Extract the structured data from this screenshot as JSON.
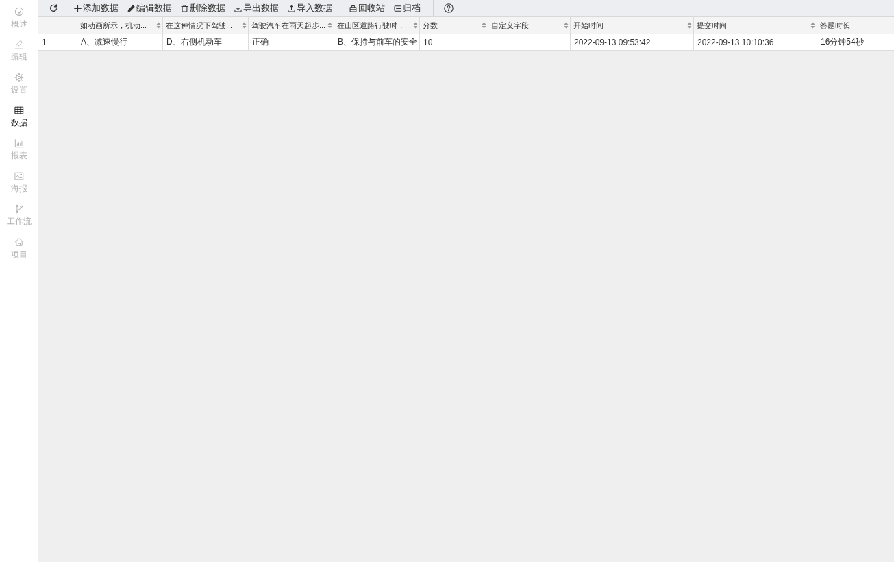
{
  "sidebar": {
    "items": [
      {
        "label": "概述",
        "selected": false
      },
      {
        "label": "编辑",
        "selected": false
      },
      {
        "label": "设置",
        "selected": false
      },
      {
        "label": "数据",
        "selected": true
      },
      {
        "label": "报表",
        "selected": false
      },
      {
        "label": "海报",
        "selected": false
      },
      {
        "label": "工作流",
        "selected": false
      },
      {
        "label": "项目",
        "selected": false
      }
    ]
  },
  "toolbar": {
    "buttons": [
      "添加数据",
      "编辑数据",
      "删除数据",
      "导出数据",
      "导入数据",
      "回收站",
      "归档"
    ]
  },
  "table": {
    "columns": [
      {
        "label": "如动画所示，机动...",
        "sortable": true
      },
      {
        "label": "在这种情况下驾驶...",
        "sortable": true
      },
      {
        "label": "驾驶汽车在雨天起步...",
        "sortable": true
      },
      {
        "label": "在山区道路行驶时，...",
        "sortable": true
      },
      {
        "label": "分数",
        "sortable": true
      },
      {
        "label": "自定义字段",
        "sortable": true
      },
      {
        "label": "开始时间",
        "sortable": true
      },
      {
        "label": "提交时间",
        "sortable": true
      },
      {
        "label": "答题时长"
      }
    ],
    "rows": [
      {
        "number": "1",
        "cells": [
          "A、减速慢行",
          "D、右侧机动车",
          "正确",
          "B、保持与前车的安全",
          "10",
          null,
          "2022-09-13 09:53:42",
          "2022-09-13 10:10:36",
          "16分钟54秒"
        ]
      }
    ]
  }
}
